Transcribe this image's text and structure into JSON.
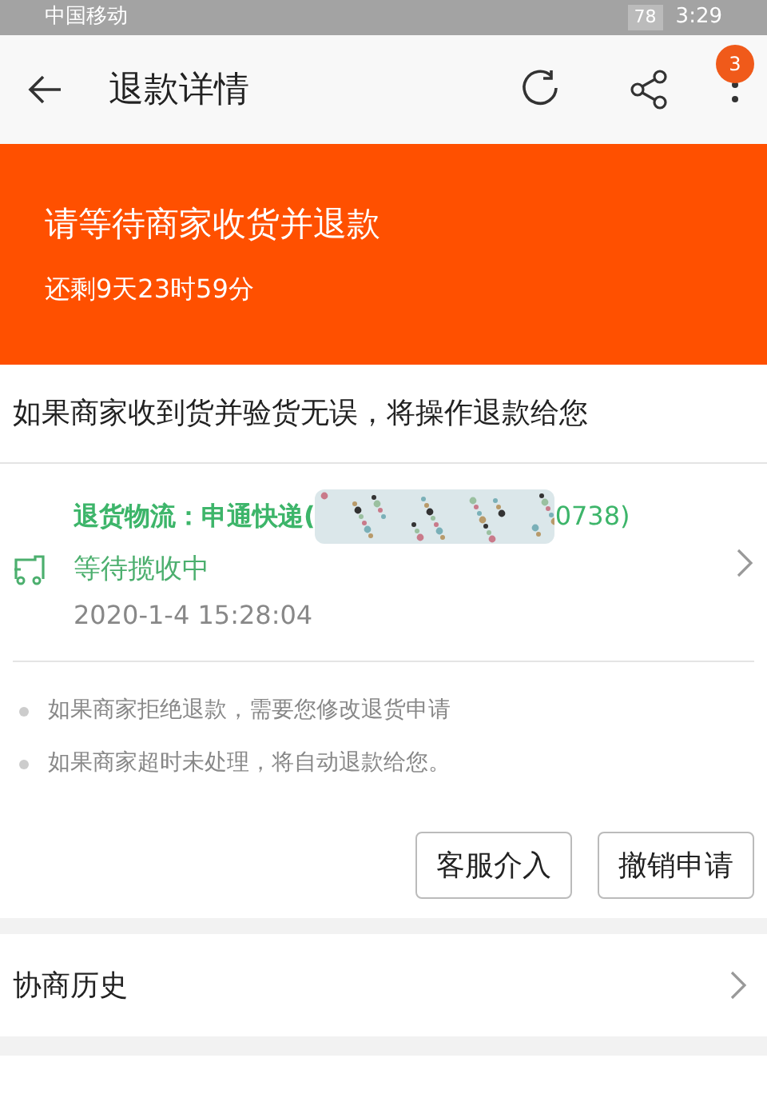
{
  "status_bar": {
    "carrier": "中国移动",
    "battery": "78",
    "time": "3:29"
  },
  "header": {
    "title": "退款详情",
    "badge": "3"
  },
  "banner": {
    "title": "请等待商家收货并退款",
    "countdown": "还剩9天23时59分"
  },
  "notice": "如果商家收到货并验货无误，将操作退款给您",
  "logistics": {
    "label": "退货物流：申通快递(",
    "number_tail": "0738)",
    "status": "等待揽收中",
    "time": "2020-1-4 15:28:04"
  },
  "tips": [
    "如果商家拒绝退款，需要您修改退货申请",
    "如果商家超时未处理，将自动退款给您。"
  ],
  "buttons": [
    "客服介入",
    "撤销申请"
  ],
  "history": {
    "label": "协商历史"
  }
}
